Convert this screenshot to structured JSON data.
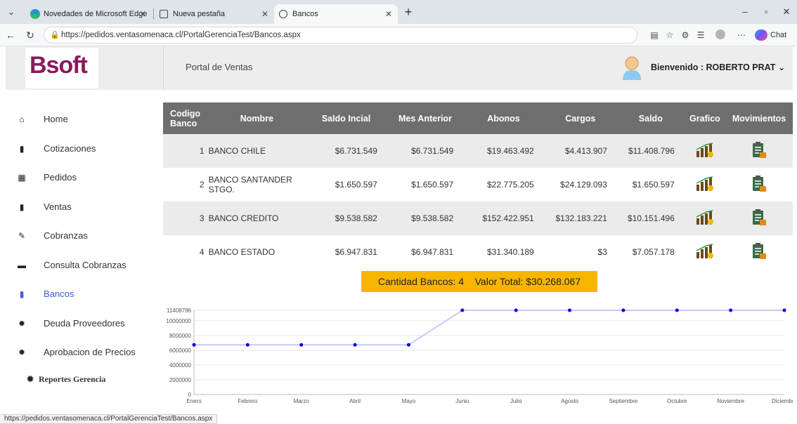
{
  "browser": {
    "tabs": [
      {
        "title": "Novedades de Microsoft Edge"
      },
      {
        "title": "Nueva pestaña"
      },
      {
        "title": "Bancos"
      }
    ],
    "url": "https://pedidos.ventasomenaca.cl/PortalGerenciaTest/Bancos.aspx",
    "chat_label": "Chat"
  },
  "header": {
    "logo_text": "Bsoft",
    "portal_title": "Portal de Ventas",
    "welcome": "Bienvenido : ROBERTO PRAT"
  },
  "sidebar": {
    "items": [
      {
        "label": "Home",
        "icon": "home-icon"
      },
      {
        "label": "Cotizaciones",
        "icon": "book-icon"
      },
      {
        "label": "Pedidos",
        "icon": "calendar-icon"
      },
      {
        "label": "Ventas",
        "icon": "book-icon"
      },
      {
        "label": "Cobranzas",
        "icon": "edit-icon"
      },
      {
        "label": "Consulta Cobranzas",
        "icon": "wallet-icon"
      },
      {
        "label": "Bancos",
        "icon": "bookmark-icon"
      },
      {
        "label": "Deuda Proveedores",
        "icon": "gear-icon"
      },
      {
        "label": "Aprobacion de Precios",
        "icon": "gear-icon"
      },
      {
        "label": "Reportes Gerencia",
        "icon": "gear-icon"
      }
    ]
  },
  "table": {
    "headers": [
      "Codigo Banco",
      "Nombre",
      "Saldo Incial",
      "Mes Anterior",
      "Abonos",
      "Cargos",
      "Saldo",
      "Grafico",
      "Movimientos"
    ],
    "rows": [
      {
        "codigo": "1",
        "nombre": "BANCO CHILE",
        "saldo_inicial": "$6.731.549",
        "mes_anterior": "$6.731.549",
        "abonos": "$19.463.492",
        "cargos": "$4.413.907",
        "saldo": "$11.408.796"
      },
      {
        "codigo": "2",
        "nombre": "BANCO SANTANDER STGO.",
        "saldo_inicial": "$1.650.597",
        "mes_anterior": "$1.650.597",
        "abonos": "$22.775.205",
        "cargos": "$24.129.093",
        "saldo": "$1.650.597"
      },
      {
        "codigo": "3",
        "nombre": "BANCO CREDITO",
        "saldo_inicial": "$9.538.582",
        "mes_anterior": "$9.538.582",
        "abonos": "$152.422.951",
        "cargos": "$132.183.221",
        "saldo": "$10.151.496"
      },
      {
        "codigo": "4",
        "nombre": "BANCO ESTADO",
        "saldo_inicial": "$6.947.831",
        "mes_anterior": "$6.947.831",
        "abonos": "$31.340.189",
        "cargos": "$3",
        "saldo": "$7.057.178"
      }
    ]
  },
  "summary": {
    "text": "Cantidad Bancos: 4    Valor Total: $30.268.067"
  },
  "status_url": "https://pedidos.ventasomenaca.cl/PortalGerenciaTest/Bancos.aspx",
  "colors": {
    "header_row": "#6e6e6e",
    "summary_bg": "#f7b500",
    "active_link": "#3b5bdb",
    "line": "#c9c9f5",
    "point": "#0000ee"
  },
  "chart_data": {
    "type": "line",
    "categories": [
      "Enero",
      "Febrero",
      "Marzo",
      "Abril",
      "Mayo",
      "Junio",
      "Julio",
      "Agosto",
      "Septiembre",
      "Octubre",
      "Noviembre",
      "Diciembre"
    ],
    "series": [
      {
        "values": [
          6731549,
          6731549,
          6731549,
          6731549,
          6731549,
          11408796,
          11408796,
          11408796,
          11408796,
          11408796,
          11408796,
          11408796
        ]
      }
    ],
    "yticks": [
      "0",
      "2000000",
      "4000000",
      "6000000",
      "8000000",
      "10000000",
      "11408796"
    ],
    "ylim": [
      0,
      11408796
    ],
    "grid": true
  }
}
